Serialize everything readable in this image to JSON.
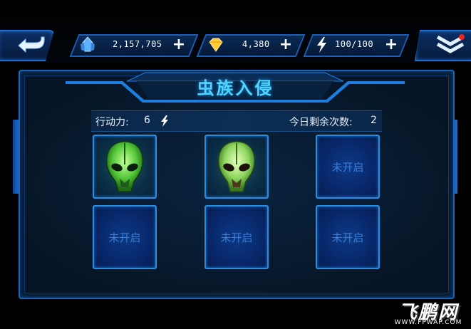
{
  "topbar": {
    "crystals": "2,157,705",
    "diamonds": "4,380",
    "energy": "100/100",
    "colors": {
      "crystal": "#5fb0ff",
      "diamond": "#ffcc33",
      "energy": "#ffffff",
      "accent": "#1f6fd0"
    }
  },
  "panel": {
    "title": "虫族入侵",
    "action_label": "行动力:",
    "action_value": "6",
    "remaining_label": "今日剩余次数:",
    "remaining_value": "2"
  },
  "slots": [
    {
      "state": "unlocked",
      "icon": "alien-skull-icon"
    },
    {
      "state": "unlocked",
      "icon": "alien-skull-icon"
    },
    {
      "state": "locked",
      "label": "未开启"
    },
    {
      "state": "locked",
      "label": "未开启"
    },
    {
      "state": "locked",
      "label": "未开启"
    },
    {
      "state": "locked",
      "label": "未开启"
    }
  ],
  "watermark": {
    "brand": "飞鹏网",
    "url": "WWW.FPWAP.COM"
  }
}
